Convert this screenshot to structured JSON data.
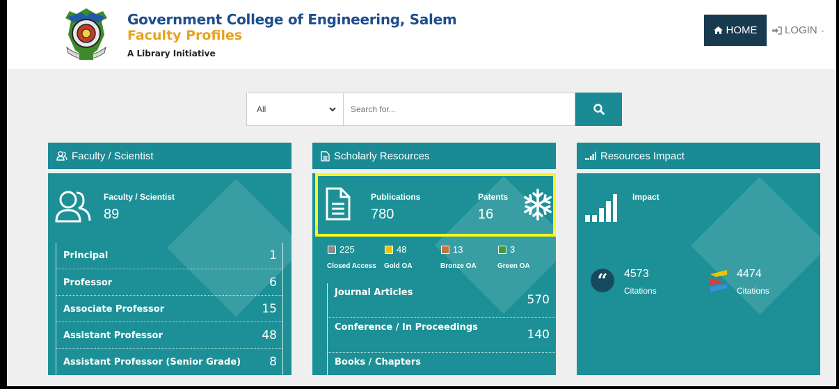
{
  "header": {
    "title": "Government College of Engineering, Salem",
    "subtitle": "Faculty Profiles",
    "tagline": "A Library Initiative",
    "nav": {
      "home": "HOME",
      "login": "LOGIN"
    }
  },
  "search": {
    "category_selected": "All",
    "placeholder": "Search for..."
  },
  "faculty_card": {
    "header": "Faculty / Scientist",
    "label": "Faculty / Scientist",
    "count": "89",
    "rows": [
      {
        "label": "Principal",
        "value": "1"
      },
      {
        "label": "Professor",
        "value": "6"
      },
      {
        "label": "Associate Professor",
        "value": "15"
      },
      {
        "label": "Assistant Professor",
        "value": "48"
      },
      {
        "label": "Assistant Professor (Senior Grade)",
        "value": "8"
      }
    ]
  },
  "scholarly_card": {
    "header": "Scholarly Resources",
    "publications_label": "Publications",
    "publications_count": "780",
    "patents_label": "Patents",
    "patents_count": "16",
    "open_access": [
      {
        "count": "225",
        "label": "Closed Access",
        "color": "#8a8a8a"
      },
      {
        "count": "48",
        "label": "Gold OA",
        "color": "#f2c200"
      },
      {
        "count": "13",
        "label": "Bronze OA",
        "color": "#c8733a"
      },
      {
        "count": "3",
        "label": "Green OA",
        "color": "#3f9a3a"
      }
    ],
    "rows": [
      {
        "label": "Journal Articles",
        "value": "570"
      },
      {
        "label": "Conference / In Proceedings",
        "value": "140"
      },
      {
        "label": "Books / Chapters",
        "value": ""
      }
    ]
  },
  "impact_card": {
    "header": "Resources Impact",
    "label": "Impact",
    "citations": [
      {
        "count": "4573",
        "label": "Citations",
        "icon": "quote-icon"
      },
      {
        "count": "4474",
        "label": "Citations",
        "icon": "crossref-icon"
      }
    ]
  },
  "colors": {
    "teal": "#1a8a94",
    "navy": "#183a4e",
    "highlight": "#f7f71e",
    "gold": "#e8a21f"
  }
}
